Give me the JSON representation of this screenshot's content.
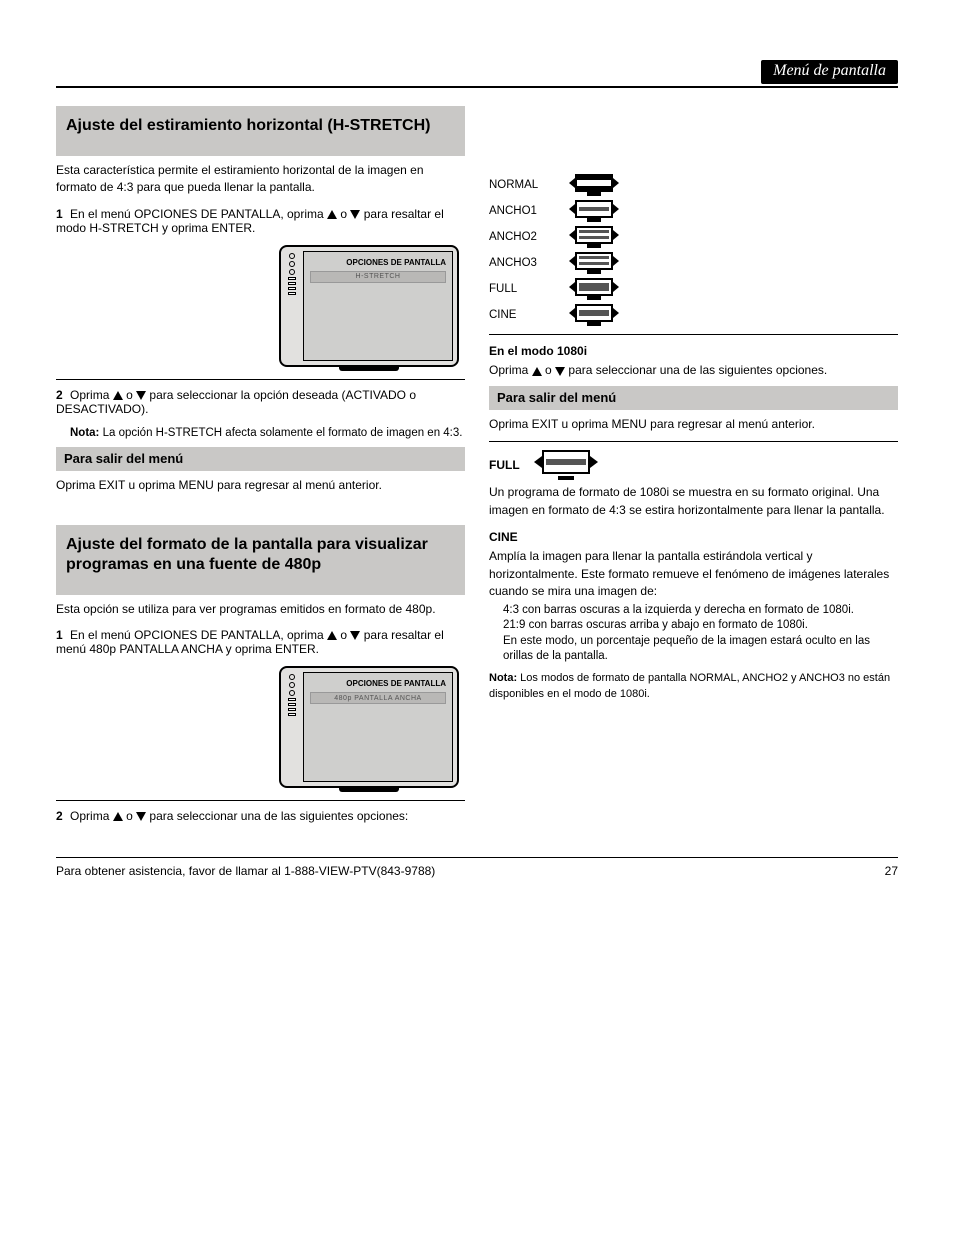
{
  "banner": "Menú de pantalla",
  "left": {
    "section1": {
      "heading": "Ajuste del estiramiento horizontal (H-STRETCH)",
      "intro": "Esta característica permite el estiramiento horizontal de la imagen en formato de 4:3 para que pueda llenar la pantalla.",
      "step1_label": "1",
      "step1_a": "En el menú OPCIONES DE PANTALLA, oprima ",
      "step1_b": " o ",
      "step1_c": " para resaltar el modo H-STRETCH y oprima ENTER.",
      "tv_screen_title": "OPCIONES DE PANTALLA",
      "tv_bar_label": "H-STRETCH",
      "step2_label": "2",
      "step2_a": "Oprima ",
      "step2_b": " o ",
      "step2_c": " para seleccionar la opción deseada (ACTIVADO o DESACTIVADO).",
      "note_title": "Nota:",
      "note_body": " La opción H-STRETCH afecta solamente el formato de imagen en 4:3.",
      "exit_title": "Para salir del menú",
      "exit_body": " Oprima EXIT u oprima MENU para regresar al menú anterior."
    },
    "section2": {
      "heading": "Ajuste del formato de la pantalla para visualizar programas en una fuente de 480p",
      "intro": "Esta opción se utiliza para ver programas emitidos en formato de 480p.",
      "step1_label": "1",
      "step1_a": "En el menú OPCIONES DE PANTALLA, oprima ",
      "step1_b": " o ",
      "step1_c": " para resaltar el menú 480p PANTALLA ANCHA y oprima ENTER.",
      "tv_screen_title": "OPCIONES DE PANTALLA",
      "tv_bar_label": "480p PANTALLA ANCHA",
      "step2_label": "2",
      "step2_a": "Oprima ",
      "step2_b": " o ",
      "step2_c": " para seleccionar una de las siguientes opciones:"
    }
  },
  "right": {
    "formats": [
      "NORMAL",
      "ANCHO1",
      "ANCHO2",
      "ANCHO3",
      "FULL",
      "CINE"
    ],
    "heading_1080i": "En el modo 1080i",
    "step_1080i_a": "Oprima ",
    "step_1080i_b": " o ",
    "step_1080i_c": " para seleccionar una de las siguientes opciones.",
    "exit_title": "Para salir del menú",
    "exit_body": " Oprima EXIT u oprima MENU para regresar al menú anterior.",
    "full": {
      "label": "FULL",
      "desc": "Un programa de formato de 1080i se muestra en su formato original. Una imagen en formato de 4:3 se estira horizontalmente para llenar la pantalla."
    },
    "cine": {
      "label": "CINE",
      "intro": "Amplía la imagen para llenar la pantalla estirándola vertical y horizontalmente. Este formato remueve el fenómeno de imágenes laterales cuando se mira una imagen de:",
      "p1": "4:3 con barras oscuras a la izquierda y derecha en formato de 1080i.",
      "p2": "21:9 con barras oscuras arriba y abajo en formato de 1080i.",
      "p3": "En este modo, un porcentaje pequeño de la imagen estará oculto en las orillas de la pantalla."
    },
    "note_title": "Nota:",
    "note_body": " Los modos de formato de pantalla NORMAL, ANCHO2 y ANCHO3 no están disponibles en el modo de 1080i."
  },
  "footer": {
    "left": "Para obtener asistencia, favor de llamar al 1-888-VIEW-PTV(843-9788)",
    "right": "27"
  }
}
